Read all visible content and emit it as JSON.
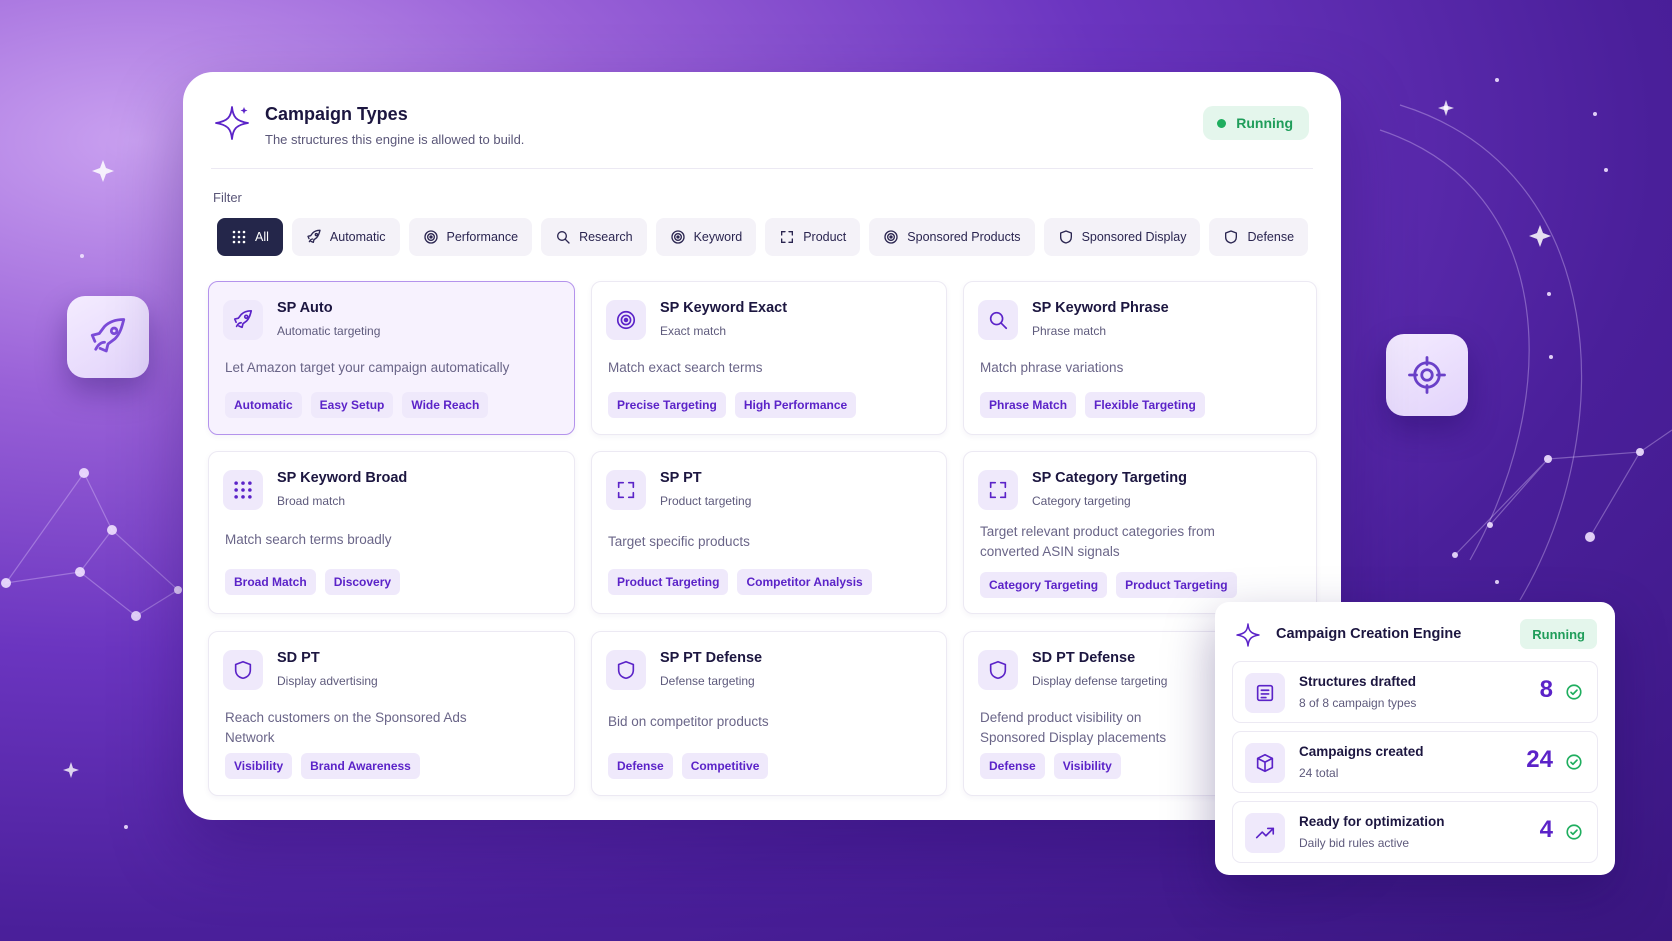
{
  "header": {
    "title": "Campaign Types",
    "subtitle": "The structures this engine is allowed to build.",
    "status": "Running"
  },
  "filter": {
    "label": "Filter",
    "chips": [
      {
        "label": "All",
        "icon": "grid-icon",
        "active": true
      },
      {
        "label": "Automatic",
        "icon": "rocket-icon"
      },
      {
        "label": "Performance",
        "icon": "target-icon"
      },
      {
        "label": "Research",
        "icon": "search-icon"
      },
      {
        "label": "Keyword",
        "icon": "target-icon"
      },
      {
        "label": "Product",
        "icon": "scan-icon"
      },
      {
        "label": "Sponsored Products",
        "icon": "target-icon"
      },
      {
        "label": "Sponsored Display",
        "icon": "shield-icon"
      },
      {
        "label": "Defense",
        "icon": "shield-icon"
      }
    ]
  },
  "cards": [
    {
      "title": "SP Auto",
      "subtitle": "Automatic targeting",
      "description": "Let Amazon target your campaign automatically",
      "icon": "rocket-icon",
      "tags": [
        "Automatic",
        "Easy Setup",
        "Wide Reach"
      ],
      "selected": true
    },
    {
      "title": "SP Keyword Exact",
      "subtitle": "Exact match",
      "description": "Match exact search terms",
      "icon": "target-icon",
      "tags": [
        "Precise Targeting",
        "High Performance"
      ]
    },
    {
      "title": "SP Keyword Phrase",
      "subtitle": "Phrase match",
      "description": "Match phrase variations",
      "icon": "search-icon",
      "tags": [
        "Phrase Match",
        "Flexible Targeting"
      ]
    },
    {
      "title": "SP Keyword Broad",
      "subtitle": "Broad match",
      "description": "Match search terms broadly",
      "icon": "grid-icon",
      "tags": [
        "Broad Match",
        "Discovery"
      ]
    },
    {
      "title": "SP PT",
      "subtitle": "Product targeting",
      "description": "Target specific products",
      "icon": "scan-icon",
      "tags": [
        "Product Targeting",
        "Competitor Analysis"
      ]
    },
    {
      "title": "SP Category Targeting",
      "subtitle": "Category targeting",
      "description": "Target relevant product categories from converted ASIN signals",
      "icon": "scan-icon",
      "tags": [
        "Category Targeting",
        "Product Targeting"
      ]
    },
    {
      "title": "SD PT",
      "subtitle": "Display advertising",
      "description": "Reach customers on the Sponsored Ads Network",
      "icon": "shield-icon",
      "tags": [
        "Visibility",
        "Brand Awareness"
      ]
    },
    {
      "title": "SP PT Defense",
      "subtitle": "Defense targeting",
      "description": "Bid on competitor products",
      "icon": "shield-icon",
      "tags": [
        "Defense",
        "Competitive"
      ]
    },
    {
      "title": "SD PT Defense",
      "subtitle": "Display defense targeting",
      "description": "Defend product visibility on Sponsored Display placements",
      "icon": "shield-icon",
      "tags": [
        "Defense",
        "Visibility"
      ]
    }
  ],
  "engine": {
    "title": "Campaign Creation Engine",
    "status": "Running",
    "stats": [
      {
        "title": "Structures drafted",
        "subtitle": "8 of 8 campaign types",
        "value": "8",
        "icon": "document-icon"
      },
      {
        "title": "Campaigns created",
        "subtitle": "24 total",
        "value": "24",
        "icon": "cube-icon"
      },
      {
        "title": "Ready for optimization",
        "subtitle": "Daily bid rules active",
        "value": "4",
        "icon": "trend-up-icon"
      }
    ]
  },
  "colors": {
    "accent": "#5b23c8",
    "success": "#1f9d5a",
    "active_chip": "#24264a"
  }
}
